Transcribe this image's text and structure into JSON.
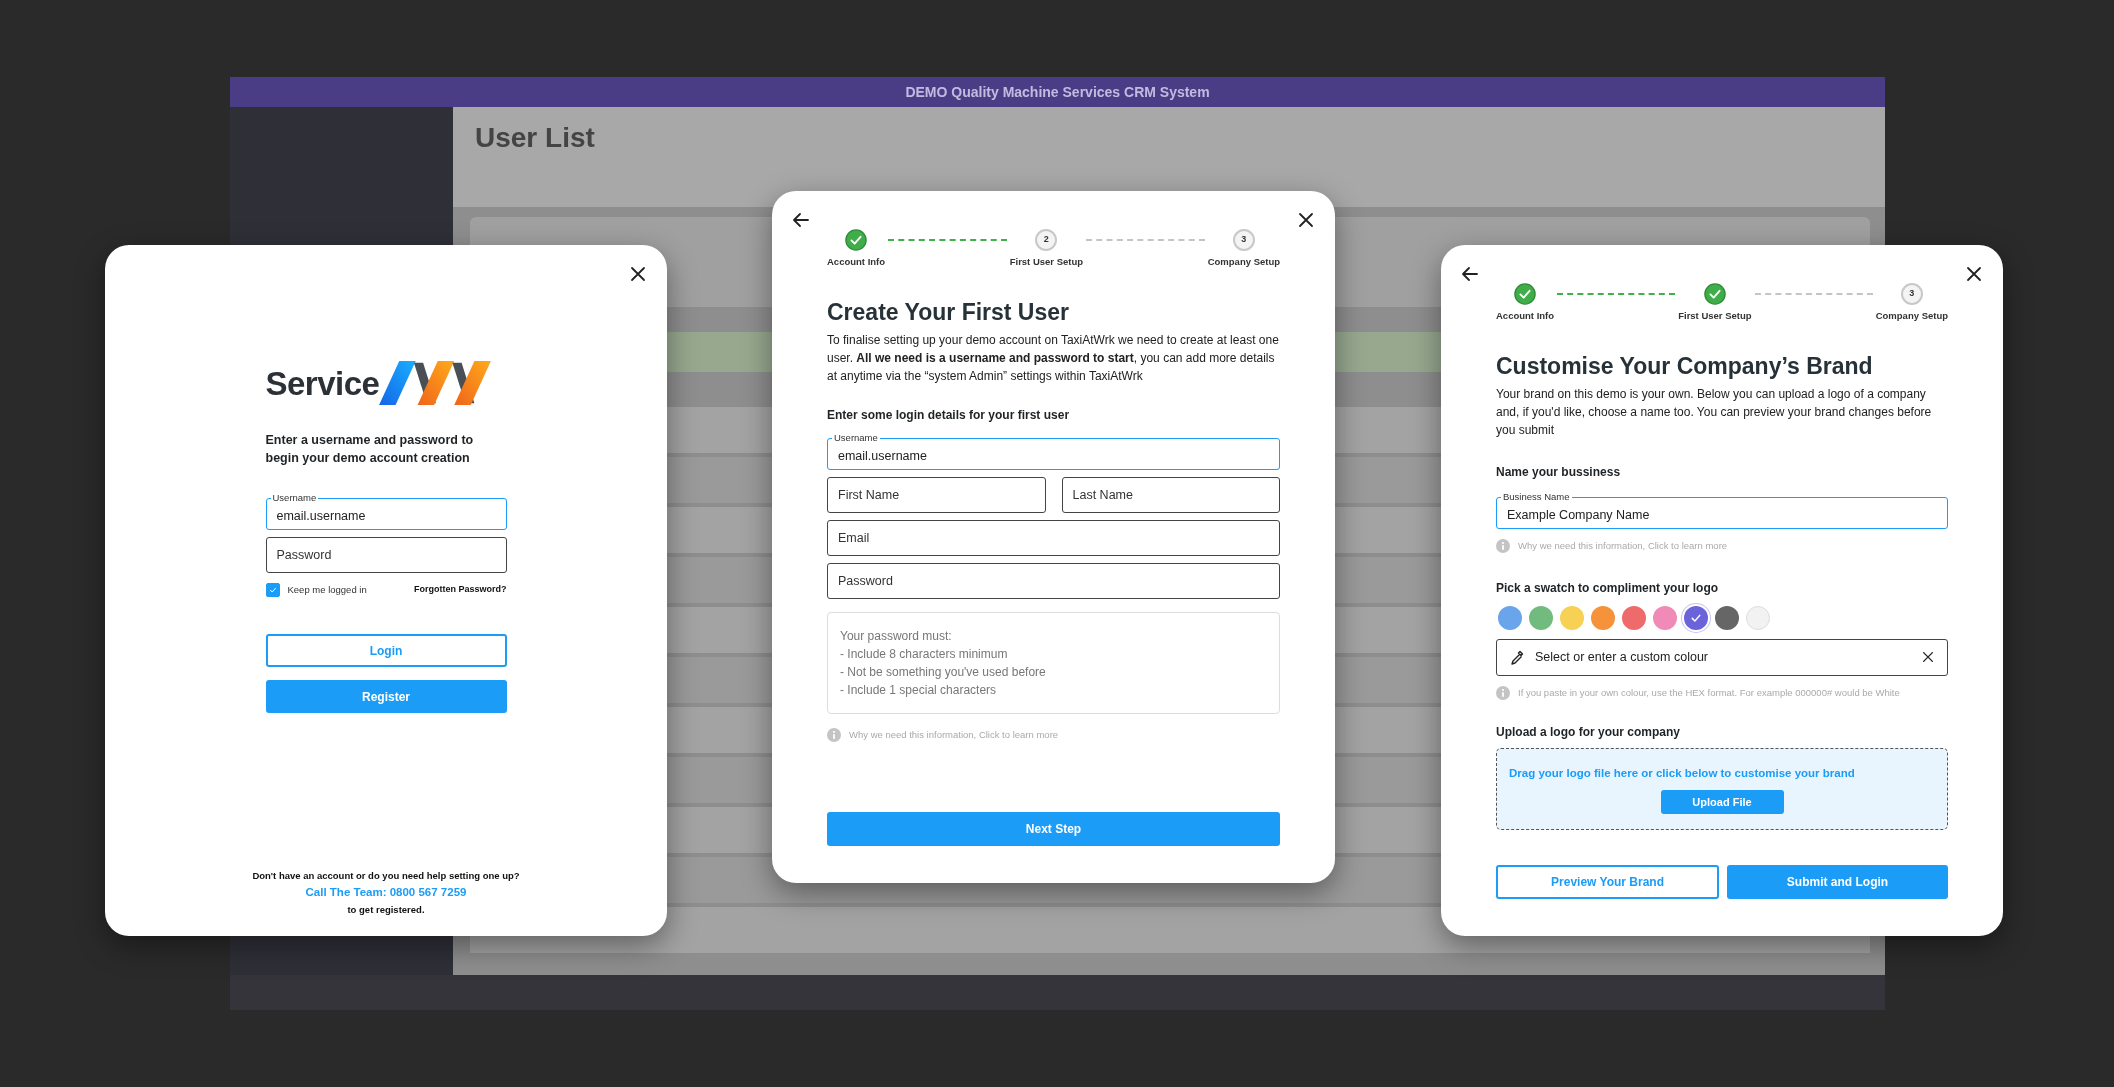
{
  "background_app": {
    "header_title": "DEMO Quality Machine Services CRM System",
    "page_title": "User List"
  },
  "login_dialog": {
    "logo_text": "Service",
    "heading": "Enter a username and password to begin your demo account creation",
    "fields": [
      {
        "label": "Username",
        "value": "email.username",
        "focused": true
      },
      {
        "placeholder": "Password",
        "focused": false
      }
    ],
    "keep_logged_in": {
      "label": "Keep me logged in",
      "checked": true
    },
    "forgot_link": "Forgotten Password?",
    "buttons": [
      {
        "label": "Login",
        "kind": "outline"
      },
      {
        "label": "Register",
        "kind": "primary"
      }
    ],
    "help_question": "Don't have an account or do you need help setting one up?",
    "help_link": "Call The Team: 0800 567 7259",
    "help_suffix": "to get registered."
  },
  "first_user_dialog": {
    "steps": [
      {
        "label": "Account Info",
        "complete": true
      },
      {
        "number": "2",
        "label": "First User Setup",
        "complete": false
      },
      {
        "number": "3",
        "label": "Company Setup",
        "complete": false
      }
    ],
    "connectors": [
      {
        "done": true
      },
      {
        "done": false
      }
    ],
    "title": "Create Your First User",
    "intro": "To finalise setting up your demo account on TaxiAtWrk we need to create at least one user. **All we need is a username and password to start**, you can add more details at anytime via the “system Admin” settings within TaxiAtWrk",
    "section_label": "Enter some login details for your first user",
    "field_rows": [
      [
        {
          "label": "Username",
          "value": "email.username",
          "focused": true
        }
      ],
      [
        {
          "placeholder": "First Name",
          "focused": false
        },
        {
          "placeholder": "Last Name",
          "focused": false
        }
      ],
      [
        {
          "placeholder": "Email",
          "focused": false
        }
      ],
      [
        {
          "placeholder": "Password",
          "focused": false
        }
      ]
    ],
    "requirements": [
      "Your password must:",
      "- Include 8 characters minimum",
      "- Not be something you've used before",
      "- Include 1 special characters"
    ],
    "info_note": "Why we need this information, Click to learn more",
    "buttons": [
      {
        "label": "Next Step",
        "kind": "primary"
      }
    ]
  },
  "brand_dialog": {
    "steps": [
      {
        "label": "Account Info",
        "complete": true
      },
      {
        "label": "First User Setup",
        "complete": true
      },
      {
        "number": "3",
        "label": "Company Setup",
        "complete": false
      }
    ],
    "connectors": [
      {
        "done": true
      },
      {
        "done": false
      }
    ],
    "title": "Customise Your Company’s Brand",
    "intro": "Your brand on this demo is your own. Below you can upload a logo of a company and, if you'd like, choose a name too. You can preview your brand changes before you submit",
    "business_label": "Name your bussiness",
    "business_field": {
      "label": "Business Name",
      "value": "Example Company Name",
      "focused": true
    },
    "business_note": "Why we need this information, Click to learn more",
    "swatch_label": "Pick a swatch to compliment your logo",
    "swatches": [
      {
        "color": "#6aa4ea",
        "selected": false
      },
      {
        "color": "#72bb7e",
        "selected": false
      },
      {
        "color": "#f7d154",
        "selected": false
      },
      {
        "color": "#f5923a",
        "selected": false
      },
      {
        "color": "#ef6b6b",
        "selected": false
      },
      {
        "color": "#f08bb8",
        "selected": false
      },
      {
        "color": "#6a63d9",
        "selected": true
      },
      {
        "color": "#666666",
        "selected": false
      },
      {
        "color": "#f2f2f2",
        "selected": false
      }
    ],
    "colour_field": {
      "placeholder": "Select or enter a custom colour"
    },
    "colour_note": "If you paste in your own colour, use the HEX format. For example 000000# would be White",
    "upload_label": "Upload a logo for your company",
    "dropzone": {
      "hint": "Drag your logo file here or click below to customise your brand",
      "button": "Upload File"
    },
    "buttons": [
      {
        "label": "Preview Your Brand",
        "kind": "outline"
      },
      {
        "label": "Submit and Login",
        "kind": "primary"
      }
    ]
  }
}
